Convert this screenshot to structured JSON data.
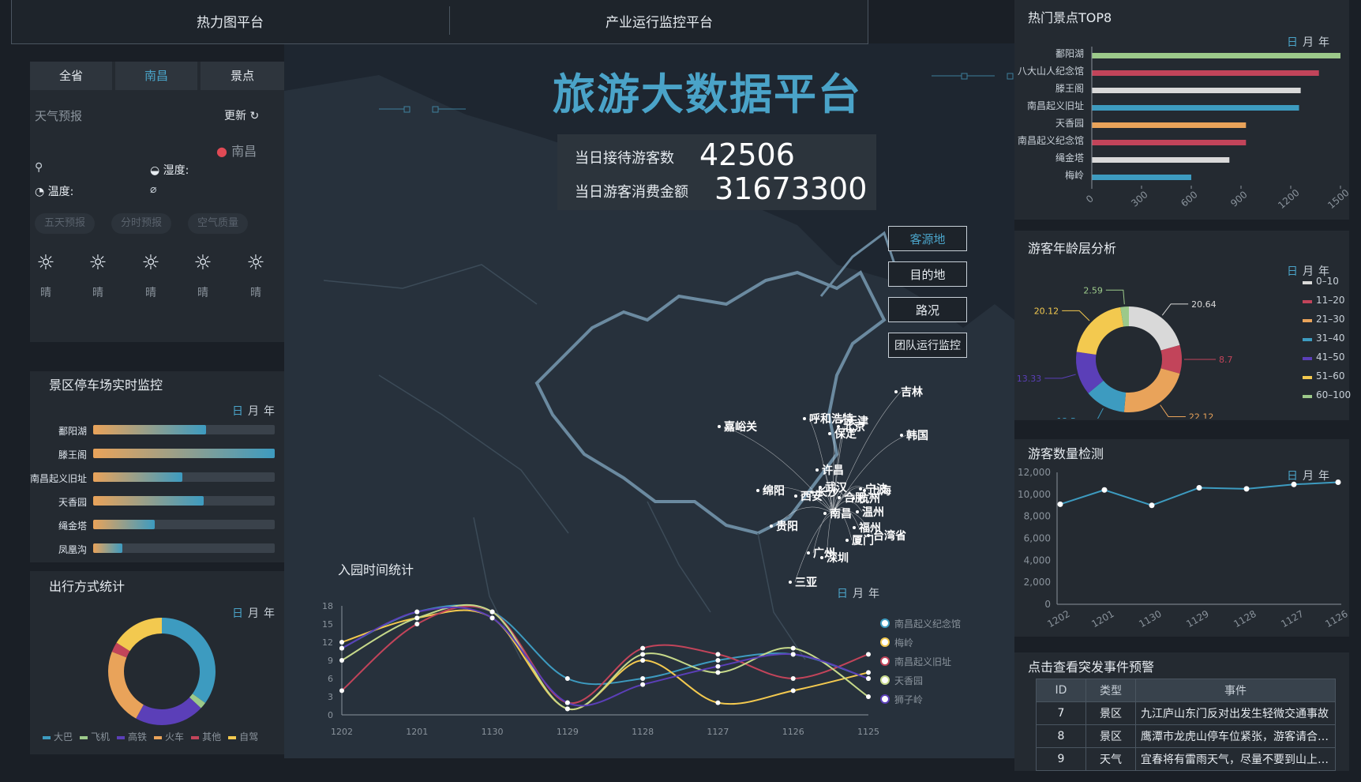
{
  "header": {
    "tab1": "热力图平台",
    "tab2": "产业运行监控平台",
    "title": "旅游大数据平台"
  },
  "stats": {
    "visitors_label": "当日接待游客数",
    "visitors_value": "42506",
    "spend_label": "当日游客消费金额",
    "spend_value": "31673300"
  },
  "left_tabs": [
    "全省",
    "南昌",
    "景点"
  ],
  "weather": {
    "title": "天气预报",
    "refresh": "更新",
    "city": "南昌",
    "humidity_label": "湿度:",
    "temp_label": "温度:",
    "chips": [
      "五天预报",
      "分时预报",
      "空气质量"
    ],
    "days": [
      "晴",
      "晴",
      "晴",
      "晴",
      "晴"
    ]
  },
  "range_labels": [
    "日",
    "月",
    "年"
  ],
  "parking": {
    "title": "景区停车场实时监控",
    "items": [
      {
        "name": "鄱阳湖",
        "value": 0.62
      },
      {
        "name": "滕王阁",
        "value": 1.0
      },
      {
        "name": "南昌起义旧址",
        "value": 0.49
      },
      {
        "name": "天香园",
        "value": 0.61
      },
      {
        "name": "绳金塔",
        "value": 0.34
      },
      {
        "name": "凤凰沟",
        "value": 0.16
      }
    ]
  },
  "travel": {
    "title": "出行方式统计",
    "legend": [
      "大巴",
      "飞机",
      "高铁",
      "火车",
      "其他",
      "自驾"
    ],
    "colors": [
      "#3d9bc0",
      "#9cc98a",
      "#5b3fb8",
      "#e9a35a",
      "#c2445a",
      "#f3c94f"
    ]
  },
  "map_buttons": [
    "客源地",
    "目的地",
    "路况",
    "团队运行监控"
  ],
  "map_cities": [
    "嘉峪关",
    "呼和浩特",
    "北京",
    "保定",
    "吉林",
    "韩国",
    "许昌",
    "绵阳",
    "贵阳",
    "福州",
    "厦门",
    "台湾省",
    "三亚",
    "南昌",
    "杭州",
    "宁波",
    "上海",
    "深圳",
    "广州",
    "长沙",
    "武汉",
    "天津",
    "西安",
    "温州",
    "合肥"
  ],
  "entry": {
    "title": "入园时间统计",
    "legend": [
      "南昌起义纪念馆",
      "梅岭",
      "南昌起义旧址",
      "天香园",
      "狮子岭"
    ]
  },
  "top8": {
    "title": "热门景点TOP8",
    "items": [
      "鄱阳湖",
      "八大山人纪念馆",
      "滕王阁",
      "南昌起义旧址",
      "天香园",
      "南昌起义纪念馆",
      "绳金塔",
      "梅岭"
    ]
  },
  "age": {
    "title": "游客年龄层分析",
    "legend": [
      "0–10",
      "11–20",
      "21–30",
      "31–40",
      "41–50",
      "51–60",
      "60–100"
    ],
    "colors": [
      "#d9d9d9",
      "#c2445a",
      "#e9a35a",
      "#3d9bc0",
      "#5b3fb8",
      "#f3c94f",
      "#9cc98a"
    ]
  },
  "count": {
    "title": "游客数量检测"
  },
  "events": {
    "title": "点击查看突发事件预警",
    "headers": [
      "ID",
      "类型",
      "事件"
    ],
    "rows": [
      [
        "7",
        "景区",
        "九江庐山东门反对出发生轻微交通事故"
      ],
      [
        "8",
        "景区",
        "鹰潭市龙虎山停车位紧张，游客请合…"
      ],
      [
        "9",
        "天气",
        "宜春将有雷雨天气，尽量不要到山上…"
      ]
    ]
  },
  "chart_data": [
    {
      "type": "bar",
      "title": "热门景点TOP8",
      "categories": [
        "鄱阳湖",
        "八大山人纪念馆",
        "滕王阁",
        "南昌起义旧址",
        "天香园",
        "南昌起义纪念馆",
        "绳金塔",
        "梅岭"
      ],
      "values": [
        1500,
        1370,
        1260,
        1250,
        930,
        930,
        830,
        600
      ],
      "colors": [
        "#9cc98a",
        "#c2445a",
        "#d9d9d9",
        "#3d9bc0",
        "#e9a35a",
        "#c2445a",
        "#d9d9d9",
        "#3d9bc0"
      ],
      "xticks": [
        "0",
        "300",
        "600",
        "900",
        "1200",
        "1500"
      ],
      "xlim": [
        0,
        1500
      ]
    },
    {
      "type": "pie",
      "title": "游客年龄层分析",
      "categories": [
        "0–10",
        "11–20",
        "21–30",
        "31–40",
        "41–50",
        "51–60",
        "60–100"
      ],
      "values": [
        20.64,
        8.7,
        22.12,
        12.5,
        13.33,
        20.12,
        2.59
      ]
    },
    {
      "type": "line",
      "title": "游客数量检测",
      "categories": [
        "1202",
        "1201",
        "1130",
        "1129",
        "1128",
        "1127",
        "1126"
      ],
      "values": [
        9100,
        10400,
        9000,
        10600,
        10500,
        10900,
        11100
      ],
      "yticks": [
        "0",
        "2,000",
        "4,000",
        "6,000",
        "8,000",
        "10,000",
        "12,000"
      ],
      "ylim": [
        0,
        12000
      ]
    },
    {
      "type": "line",
      "title": "入园时间统计",
      "categories": [
        "1202",
        "1201",
        "1130",
        "1129",
        "1128",
        "1127",
        "1126",
        "1125"
      ],
      "yticks": [
        "0",
        "3",
        "6",
        "9",
        "12",
        "15",
        "18"
      ],
      "ylim": [
        0,
        18
      ],
      "series": [
        {
          "name": "南昌起义纪念馆",
          "color": "#3d9bc0",
          "values": [
            11,
            17,
            17,
            6,
            6,
            9,
            10,
            6
          ]
        },
        {
          "name": "梅岭",
          "color": "#f3c94f",
          "values": [
            12,
            16,
            16,
            1,
            9,
            2,
            4,
            7
          ]
        },
        {
          "name": "南昌起义旧址",
          "color": "#c2445a",
          "values": [
            4,
            15,
            17,
            2,
            11,
            10,
            6,
            10
          ]
        },
        {
          "name": "天香园",
          "color": "#c6d98a",
          "values": [
            9,
            16,
            17,
            1,
            10,
            7,
            11,
            3
          ]
        },
        {
          "name": "狮子岭",
          "color": "#5b3fb8",
          "values": [
            11,
            17,
            16,
            2,
            5,
            8,
            10,
            6
          ]
        }
      ]
    },
    {
      "type": "pie",
      "title": "出行方式统计",
      "categories": [
        "大巴",
        "飞机",
        "高铁",
        "火车",
        "其他",
        "自驾"
      ],
      "values": [
        35,
        2,
        21,
        23,
        3,
        16
      ]
    }
  ]
}
